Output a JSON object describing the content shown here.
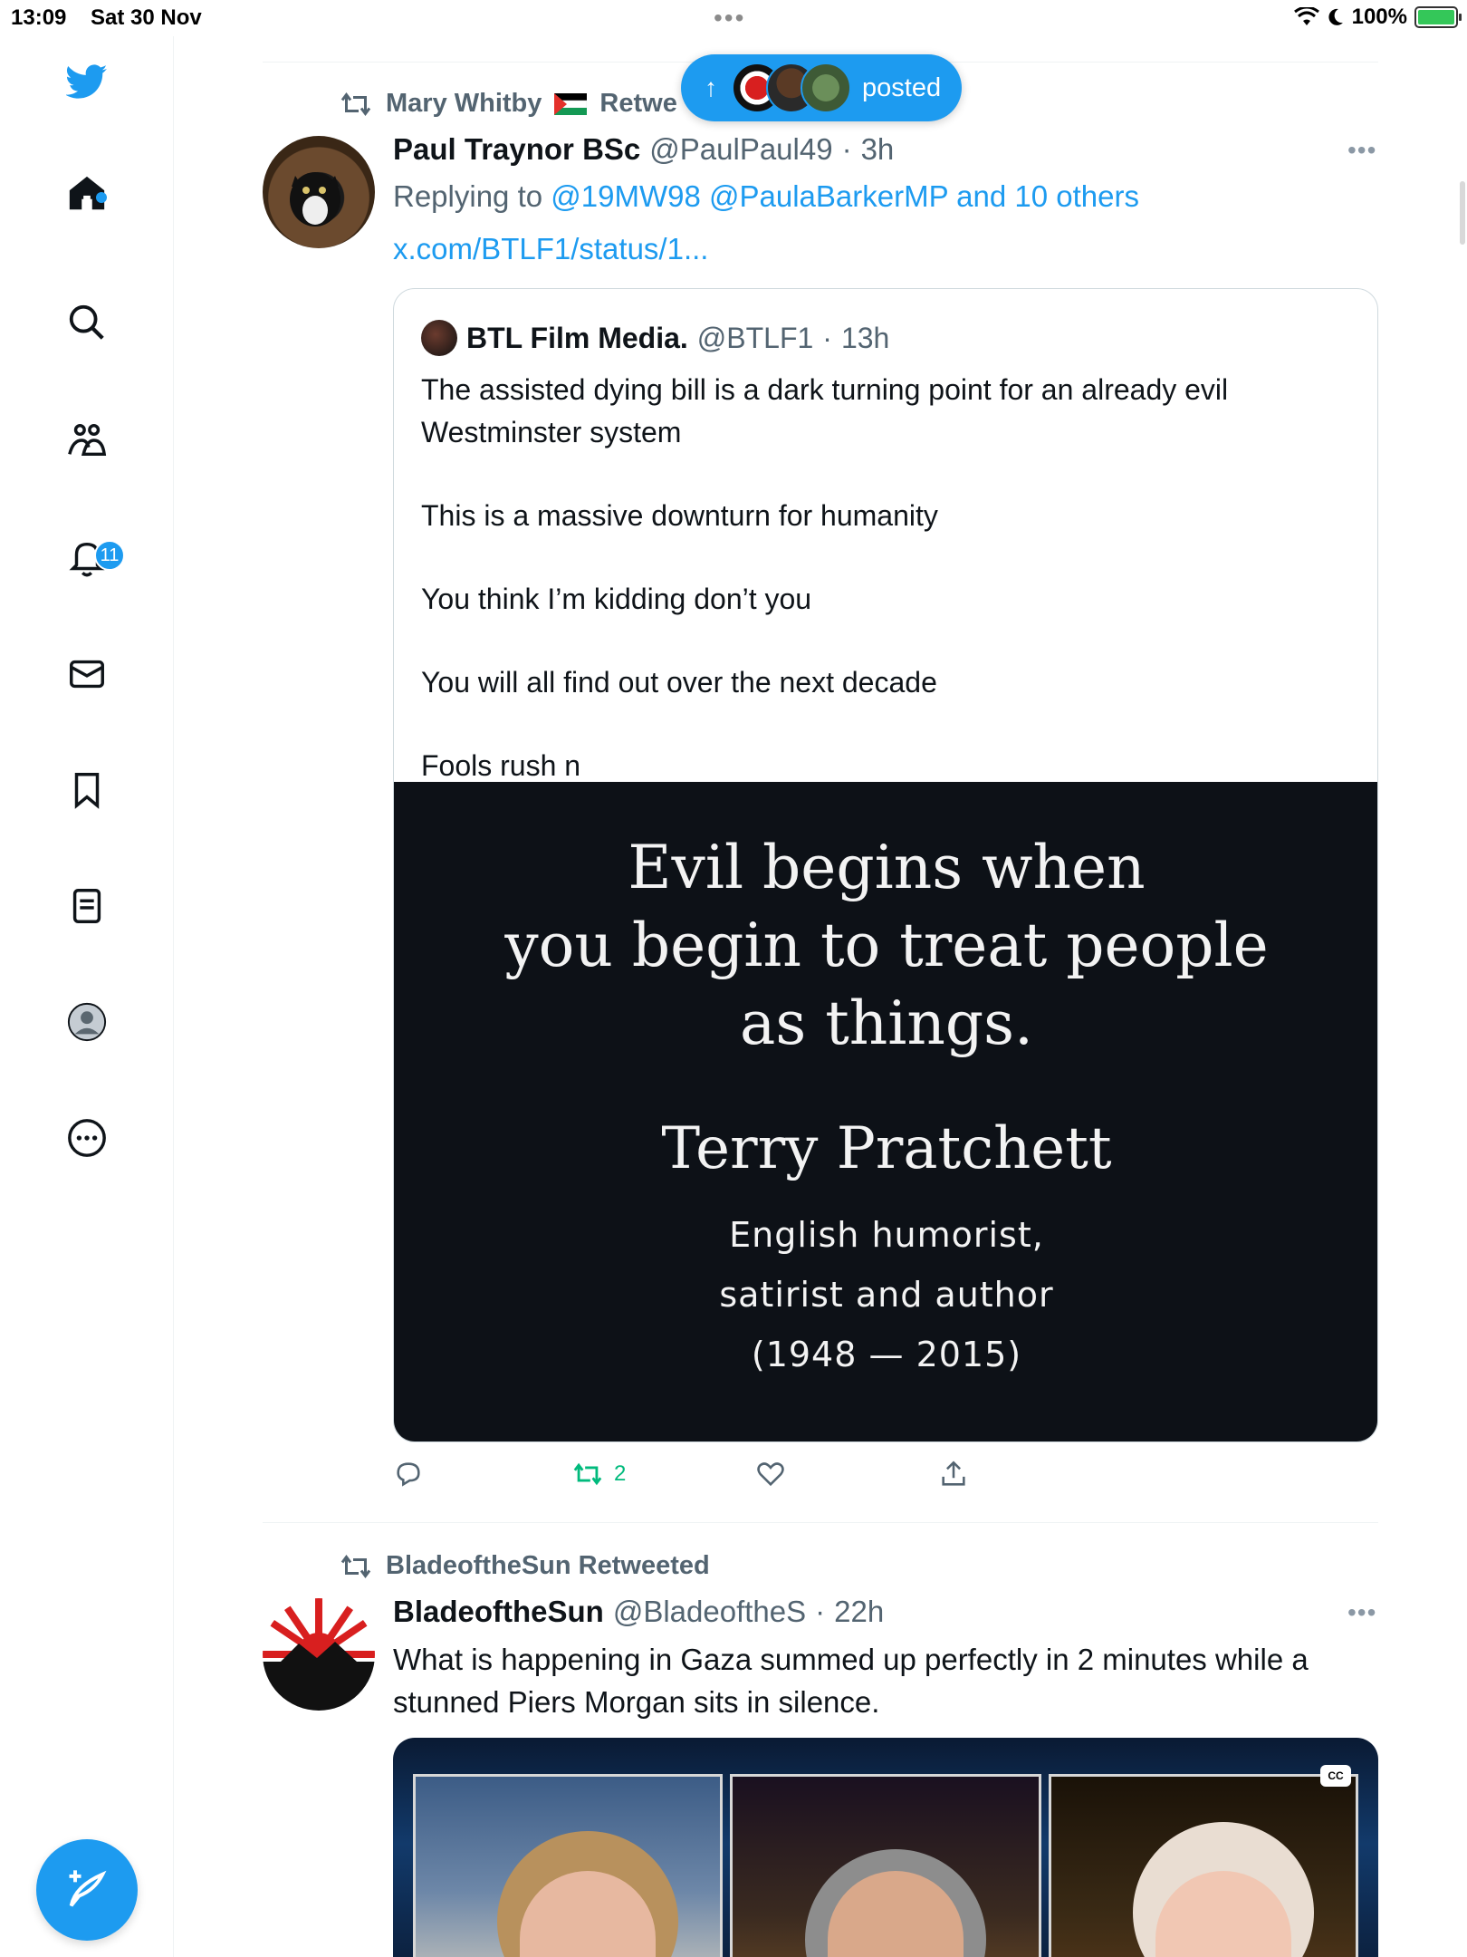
{
  "status_bar": {
    "time": "13:09",
    "date": "Sat 30 Nov",
    "battery": "100%"
  },
  "sidebar": {
    "notifications_badge": "11",
    "items": [
      {
        "name": "twitter-logo-icon"
      },
      {
        "name": "home-icon"
      },
      {
        "name": "search-icon"
      },
      {
        "name": "communities-icon"
      },
      {
        "name": "notifications-icon"
      },
      {
        "name": "messages-icon"
      },
      {
        "name": "bookmarks-icon"
      },
      {
        "name": "lists-icon"
      },
      {
        "name": "profile-icon"
      },
      {
        "name": "more-icon"
      }
    ],
    "compose_icon": "compose-tweet-icon"
  },
  "posted_pill": {
    "arrow": "↑",
    "label": "posted"
  },
  "tweet1": {
    "retweeted_by": "Mary Whitby 🇵🇸 Retweeted",
    "retweeted_by_visible": "Mary Whitby",
    "retweeted_suffix": "Retwe",
    "name": "Paul Traynor BSc",
    "handle": "@PaulPaul49",
    "time": "3h",
    "replying_prefix": "Replying to",
    "replying_to": "@19MW98 @PaulaBarkerMP and 10 others",
    "url": "x.com/BTLF1/status/1...",
    "quote": {
      "name": "BTL Film Media.",
      "handle": "@BTLF1",
      "time": "13h",
      "paragraphs": [
        "The assisted dying bill is a dark turning point for an already evil Westminster system",
        "This is a massive downturn for humanity",
        "You think I’m kidding don’t you",
        "You will all find out over the next decade",
        "Fools rush n"
      ],
      "image": {
        "line1": "Evil begins when",
        "line2": "you begin to treat people",
        "line3": "as things.",
        "author": "Terry Pratchett",
        "desc1": "English humorist,",
        "desc2": "satirist and author",
        "years": "(1948 — 2015)"
      }
    },
    "actions": {
      "retweet_count": "2"
    }
  },
  "tweet2": {
    "retweeted_by": "BladeoftheSun Retweeted",
    "name": "BladeoftheSun",
    "handle": "@BladeoftheS",
    "time": "22h",
    "text": "What is happening in Gaza summed up perfectly in 2 minutes while a stunned Piers Morgan sits in silence.",
    "cc_label": "CC"
  },
  "colors": {
    "accent": "#1d9bf0",
    "retweet_green": "#00ba7c",
    "secondary_text": "#536471",
    "border": "#cfd9de"
  }
}
